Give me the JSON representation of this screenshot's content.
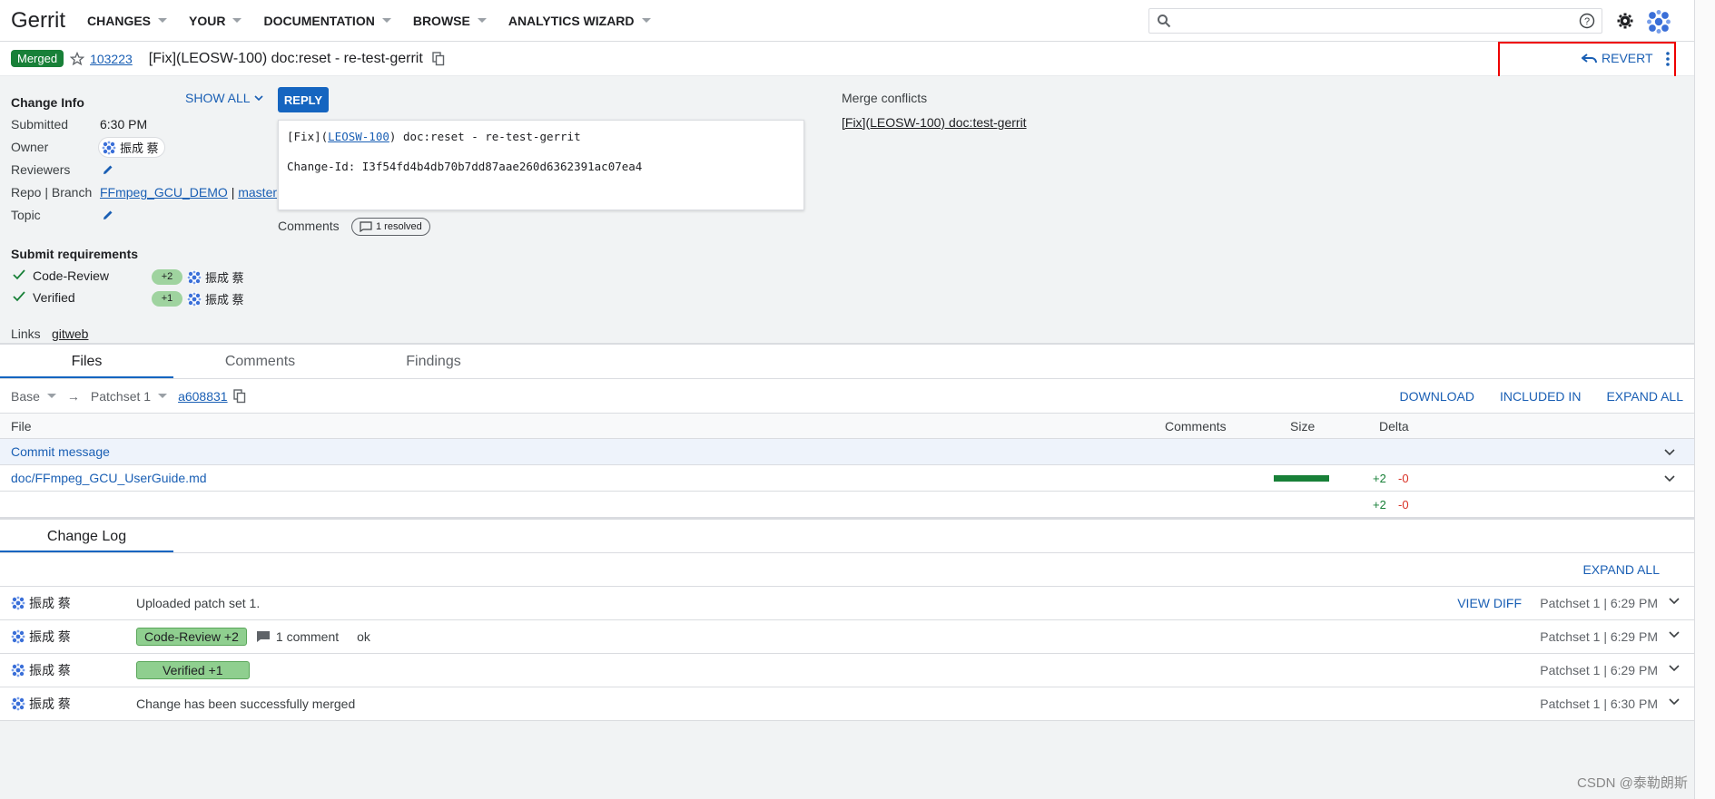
{
  "header": {
    "brand": "Gerrit",
    "menus": [
      "CHANGES",
      "YOUR",
      "DOCUMENTATION",
      "BROWSE",
      "ANALYTICS WIZARD"
    ],
    "search_placeholder": ""
  },
  "change": {
    "status": "Merged",
    "number": "103223",
    "subject": "[Fix](LEOSW-100) doc:reset - re-test-gerrit",
    "revert_label": "REVERT"
  },
  "info": {
    "change_info_title": "Change Info",
    "show_all": "SHOW ALL",
    "submitted_label": "Submitted",
    "submitted_value": "6:30 PM",
    "owner_label": "Owner",
    "owner_name": "振成 蔡",
    "reviewers_label": "Reviewers",
    "repo_branch_label": "Repo | Branch",
    "repo": "FFmpeg_GCU_DEMO",
    "branch_sep": "|",
    "branch": "master",
    "topic_label": "Topic",
    "submit_req_title": "Submit requirements",
    "requirements": [
      {
        "name": "Code-Review",
        "score": "+2",
        "voter": "振成 蔡"
      },
      {
        "name": "Verified",
        "score": "+1",
        "voter": "振成 蔡"
      }
    ],
    "links_label": "Links",
    "links_value": "gitweb"
  },
  "commit": {
    "reply": "REPLY",
    "line1_prefix": "[Fix](",
    "line1_link": "LEOSW-100",
    "line1_suffix": ") doc:reset - re-test-gerrit",
    "line2": "Change-Id: I3f54fd4b4db70b7dd87aae260d6362391ac07ea4",
    "comments_label": "Comments",
    "resolved": "1 resolved"
  },
  "merge_conflicts": {
    "title": "Merge conflicts",
    "item": "[Fix](LEOSW-100) doc:test-gerrit"
  },
  "tabs": [
    "Files",
    "Comments",
    "Findings"
  ],
  "patchbar": {
    "base": "Base",
    "arrow": "→",
    "patchset": "Patchset 1",
    "commit": "a608831",
    "download": "DOWNLOAD",
    "included_in": "INCLUDED IN",
    "expand_all": "EXPAND ALL"
  },
  "files": {
    "headers": {
      "file": "File",
      "comments": "Comments",
      "size": "Size",
      "delta": "Delta"
    },
    "commit_message": "Commit message",
    "rows": [
      {
        "path": "doc/FFmpeg_GCU_UserGuide.md",
        "plus": "+2",
        "minus": "-0"
      }
    ],
    "total_plus": "+2",
    "total_minus": "-0"
  },
  "changelog": {
    "tab": "Change Log",
    "expand_all": "EXPAND ALL",
    "view_diff": "VIEW DIFF",
    "entries": [
      {
        "author": "振成 蔡",
        "message": "Uploaded patch set 1.",
        "meta": "Patchset 1 | 6:29 PM"
      },
      {
        "author": "振成 蔡",
        "vote": "Code-Review +2",
        "comments": "1 comment",
        "extra": "ok",
        "meta": "Patchset 1 | 6:29 PM"
      },
      {
        "author": "振成 蔡",
        "vote": "Verified +1",
        "meta": "Patchset 1 | 6:29 PM"
      },
      {
        "author": "振成 蔡",
        "message": "Change has been successfully merged",
        "meta": "Patchset 1 | 6:30 PM"
      }
    ]
  },
  "watermark": "CSDN @泰勒朗斯"
}
